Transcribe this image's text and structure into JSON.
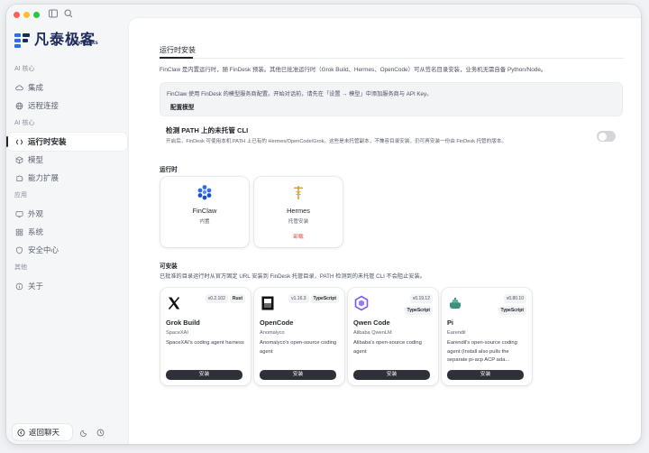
{
  "colors": {
    "accent": "#2e3138",
    "danger": "#e04848",
    "brand": "#1d2b5a",
    "window_red": "#fe5f57",
    "window_yellow": "#febc2e",
    "window_green": "#28c840"
  },
  "brand": {
    "name": "凡泰极客",
    "sub": "Finogeeks",
    "logo_icon": "finogeeks-logo-icon"
  },
  "sidebar": {
    "sections": [
      {
        "title": "AI 核心",
        "items": [
          {
            "label": "集成",
            "icon": "cloud-icon"
          },
          {
            "label": "远程连接",
            "icon": "globe-icon"
          }
        ]
      },
      {
        "title": "AI 核心",
        "items": [
          {
            "label": "运行时安装",
            "icon": "runtime-icon",
            "active": true
          },
          {
            "label": "模型",
            "icon": "cube-icon"
          },
          {
            "label": "能力扩展",
            "icon": "extension-icon"
          }
        ]
      },
      {
        "title": "应用",
        "items": [
          {
            "label": "外观",
            "icon": "monitor-icon"
          },
          {
            "label": "系统",
            "icon": "grid-icon"
          },
          {
            "label": "安全中心",
            "icon": "shield-icon"
          }
        ]
      },
      {
        "title": "其他",
        "items": [
          {
            "label": "关于",
            "icon": "info-icon"
          }
        ]
      }
    ],
    "back_label": "返回聊天"
  },
  "main": {
    "tab": "运行时安装",
    "intro": "FinClaw 是内置运行时，随 FinDesk 预装。其他已批准运行时（Grok Build、Hermes、OpenCode）可从签名目录安装，业务机无需自备 Python/Node。",
    "notice": {
      "text": "FinClaw 使用 FinDesk 的模型服务商配置。开始对话前，请先在「设置 → 模型」中添加服务商与 API Key。",
      "link": "配置模型"
    },
    "detect": {
      "title": "检测 PATH 上的未托管 CLI",
      "desc": "开启后，FinDesk 可使用本机 PATH 上已有的 Hermes/OpenCode/Grok。这些是未托管副本，不兼容目录安装，仍可再安装一份由 FinDesk 托管的版本。",
      "enabled": false
    },
    "runtime_label": "运行时",
    "runtimes": [
      {
        "name": "FinClaw",
        "sub": "内置",
        "action": ""
      },
      {
        "name": "Hermes",
        "sub": "托管安装",
        "action": "卸载"
      }
    ],
    "available_label": "可安装",
    "available_desc": "已批准的目录运行时从官方固定 URL 安装到 FinDesk 托管目录，PATH 检测到的未托管 CLI 不会阻止安装。",
    "packages": [
      {
        "name": "Grok Build",
        "vendor": "SpaceXAI",
        "version": "v0.2.102",
        "lang": "Rust",
        "desc": "SpaceXAI's coding agent harness",
        "install": "安装",
        "logo": "x-logo-icon"
      },
      {
        "name": "OpenCode",
        "vendor": "Anomalyco",
        "version": "v1.16.3",
        "lang": "TypeScript",
        "desc": "Anomalyco's open-source coding agent",
        "install": "安装",
        "logo": "opencode-logo-icon"
      },
      {
        "name": "Qwen Code",
        "vendor": "Alibaba QwenLM",
        "version": "v0.19.12",
        "lang": "TypeScript",
        "desc": "Alibaba's open-source coding agent",
        "install": "安装",
        "logo": "qwen-logo-icon"
      },
      {
        "name": "Pi",
        "vendor": "Earendil",
        "version": "v0.80.10",
        "lang": "TypeScript",
        "desc": "Earendil's open-source coding agent (Install also pulls the separate pi-acp ACP ada...",
        "install": "安装",
        "logo": "pi-logo-icon"
      }
    ]
  }
}
